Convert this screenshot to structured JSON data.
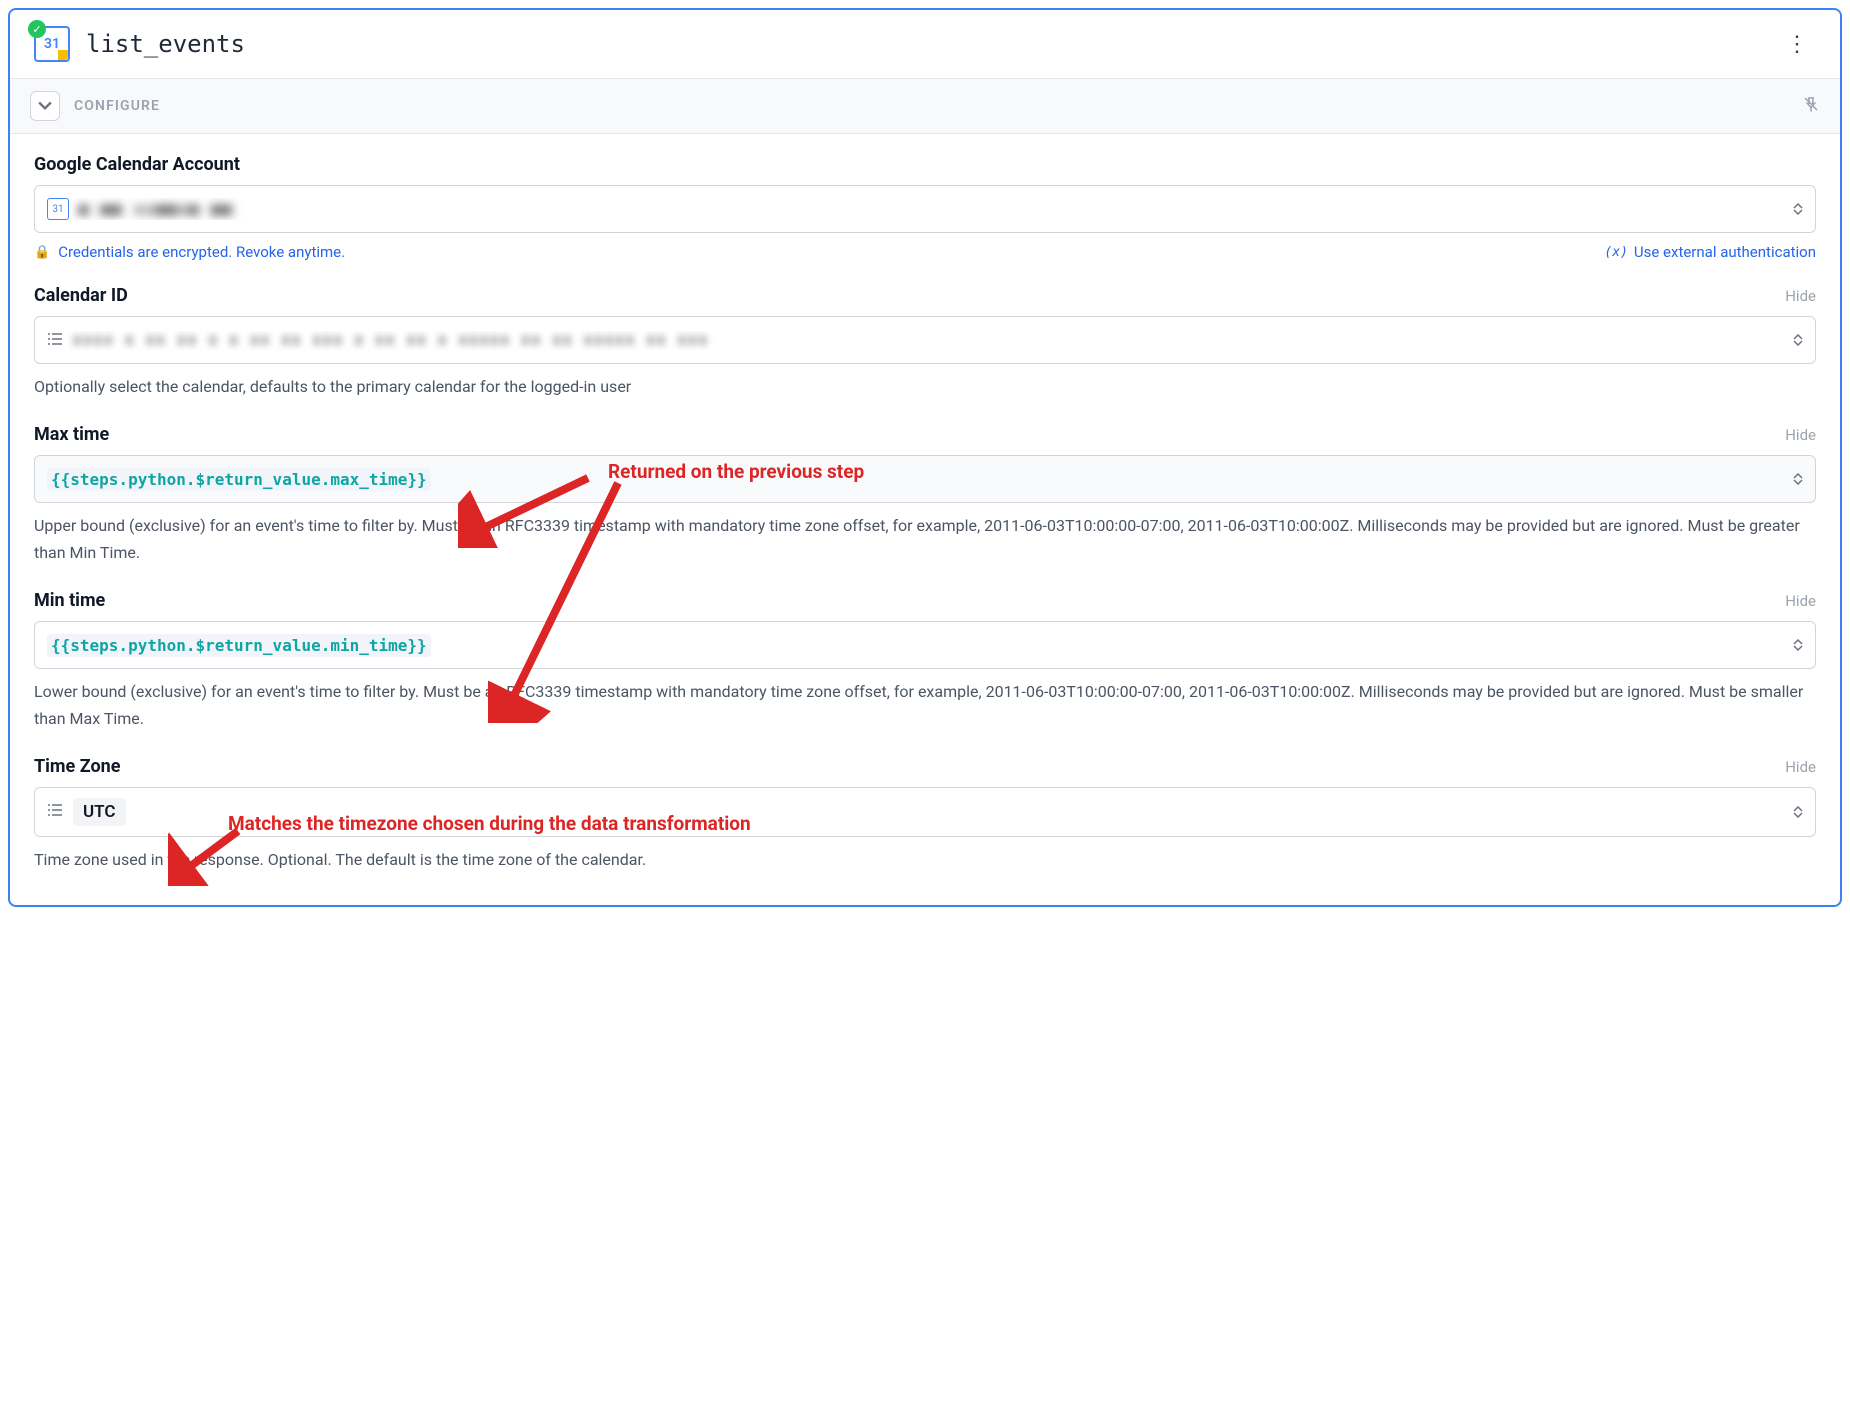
{
  "header": {
    "title": "list_events",
    "icon_text": "31"
  },
  "section": {
    "label": "CONFIGURE"
  },
  "fields": {
    "account": {
      "label": "Google Calendar Account",
      "value_redacted": "■ ■■ ▮▮■■▮■ ■■",
      "encrypted_text": "Credentials are encrypted. Revoke anytime.",
      "external_auth": "Use external authentication"
    },
    "calendar_id": {
      "label": "Calendar ID",
      "hide": "Hide",
      "value_redacted": "▮▮▮▮ ▮ ▮▮ ▮▮   ▮ ▮    ▮▮ ▮▮ ▮▮▮   ▮ ▮▮    ▮▮ ▮ ▮▮▮▮▮ ▮▮ ▮▮  ▮▮▮▮▮ ▮▮ ▮▮▮",
      "desc": "Optionally select the calendar, defaults to the primary calendar for the logged-in user"
    },
    "max_time": {
      "label": "Max time",
      "hide": "Hide",
      "value": "{{steps.python.$return_value.max_time}}",
      "desc": "Upper bound (exclusive) for an event's time to filter by. Must be an RFC3339 timestamp with mandatory time zone offset, for example, 2011-06-03T10:00:00-07:00, 2011-06-03T10:00:00Z. Milliseconds may be provided but are ignored. Must be greater than Min Time."
    },
    "min_time": {
      "label": "Min time",
      "hide": "Hide",
      "value": "{{steps.python.$return_value.min_time}}",
      "desc": "Lower bound (exclusive) for an event's time to filter by. Must be an RFC3339 timestamp with mandatory time zone offset, for example, 2011-06-03T10:00:00-07:00, 2011-06-03T10:00:00Z. Milliseconds may be provided but are ignored. Must be smaller than Max Time."
    },
    "time_zone": {
      "label": "Time Zone",
      "hide": "Hide",
      "value": "UTC",
      "desc": "Time zone used in the response. Optional. The default is the time zone of the calendar."
    }
  },
  "annotations": {
    "a1": "Returned on the previous step",
    "a2": "Matches the timezone chosen during the data transformation"
  }
}
